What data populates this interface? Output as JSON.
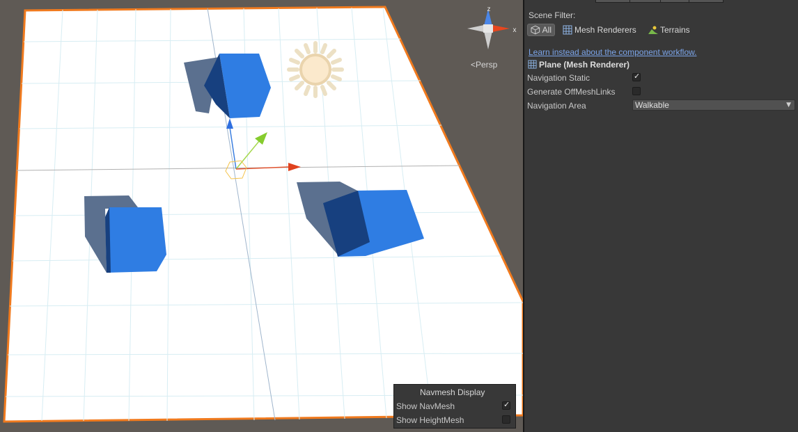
{
  "scene_view": {
    "projection_label": "<Persp",
    "gizmo_axes": {
      "y": "z",
      "x": "x"
    },
    "plane_outline_color": "#f07a1e",
    "cube_color": "#2f7de3",
    "navmesh_display": {
      "title": "Navmesh Display",
      "show_navmesh_label": "Show NavMesh",
      "show_navmesh_checked": true,
      "show_heightmesh_label": "Show HeightMesh",
      "show_heightmesh_checked": false
    }
  },
  "inspector": {
    "scene_filter_label": "Scene Filter:",
    "filters": [
      {
        "label": "All",
        "icon": "cube-icon",
        "selected": true
      },
      {
        "label": "Mesh Renderers",
        "icon": "mesh-grid-icon",
        "selected": false
      },
      {
        "label": "Terrains",
        "icon": "terrain-icon",
        "selected": false
      }
    ],
    "workflow_link": "Learn instead about the component workflow.",
    "object_title": "Plane (Mesh Renderer)",
    "navigation_static_label": "Navigation Static",
    "navigation_static_checked": true,
    "offmesh_label": "Generate OffMeshLinks",
    "offmesh_checked": false,
    "area_label": "Navigation Area",
    "area_value": "Walkable",
    "link_color": "#7ba4e8"
  }
}
